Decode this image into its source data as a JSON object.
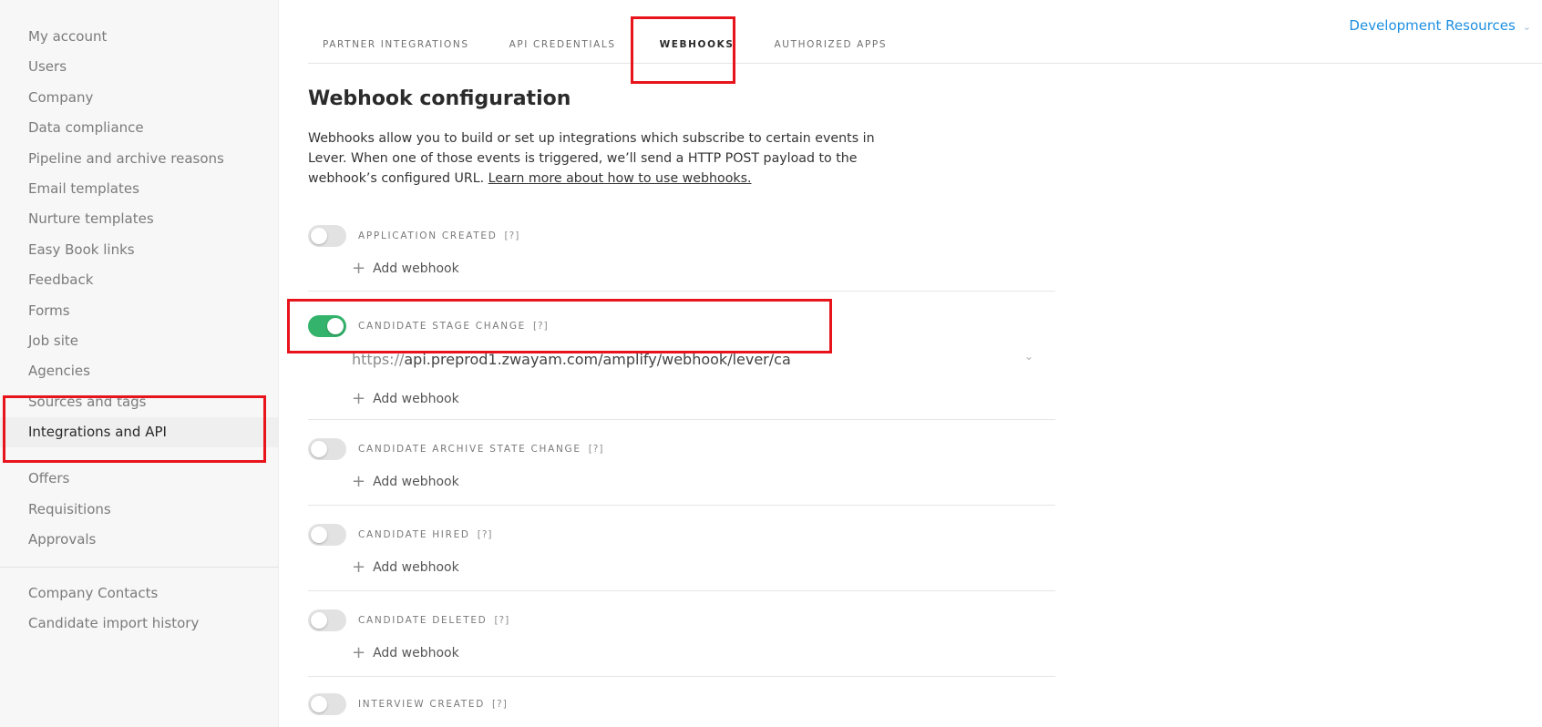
{
  "sidebar": {
    "items": [
      {
        "label": "My account"
      },
      {
        "label": "Users"
      },
      {
        "label": "Company"
      },
      {
        "label": "Data compliance"
      },
      {
        "label": "Pipeline and archive reasons"
      },
      {
        "label": "Email templates"
      },
      {
        "label": "Nurture templates"
      },
      {
        "label": "Easy Book links"
      },
      {
        "label": "Feedback"
      },
      {
        "label": "Forms"
      },
      {
        "label": "Job site"
      },
      {
        "label": "Agencies"
      },
      {
        "label": "Sources and tags"
      },
      {
        "label": "Integrations and API"
      },
      {
        "label": "Offers"
      },
      {
        "label": "Requisitions"
      },
      {
        "label": "Approvals"
      }
    ],
    "secondary": [
      {
        "label": "Company Contacts"
      },
      {
        "label": "Candidate import history"
      }
    ],
    "active": "Integrations and API"
  },
  "tabs": [
    {
      "label": "PARTNER INTEGRATIONS"
    },
    {
      "label": "API CREDENTIALS"
    },
    {
      "label": "WEBHOOKS"
    },
    {
      "label": "AUTHORIZED APPS"
    }
  ],
  "header": {
    "dev_resources": "Development Resources"
  },
  "main": {
    "title": "Webhook configuration",
    "desc_text": "Webhooks allow you to build or set up integrations which subscribe to certain events in Lever. When one of those events is triggered, we’ll send a HTTP POST payload to the webhook’s configured URL. ",
    "desc_link": "Learn more about how to use webhooks.",
    "help_label": "[?]",
    "add_webhook": "Add webhook",
    "events": [
      {
        "label": "APPLICATION CREATED",
        "enabled": false
      },
      {
        "label": "CANDIDATE STAGE CHANGE",
        "enabled": true,
        "url_prefix": "https://",
        "url_value": "api.preprod1.zwayam.com/amplify/webhook/lever/ca"
      },
      {
        "label": "CANDIDATE ARCHIVE STATE CHANGE",
        "enabled": false
      },
      {
        "label": "CANDIDATE HIRED",
        "enabled": false
      },
      {
        "label": "CANDIDATE DELETED",
        "enabled": false
      },
      {
        "label": "INTERVIEW CREATED",
        "enabled": false
      }
    ]
  },
  "colors": {
    "accent": "#1e8fe1",
    "toggle_on": "#33b36b",
    "annotation": "#e8141c"
  },
  "icons": {
    "plus": "plus-icon",
    "chevron": "chevron-down-icon"
  }
}
